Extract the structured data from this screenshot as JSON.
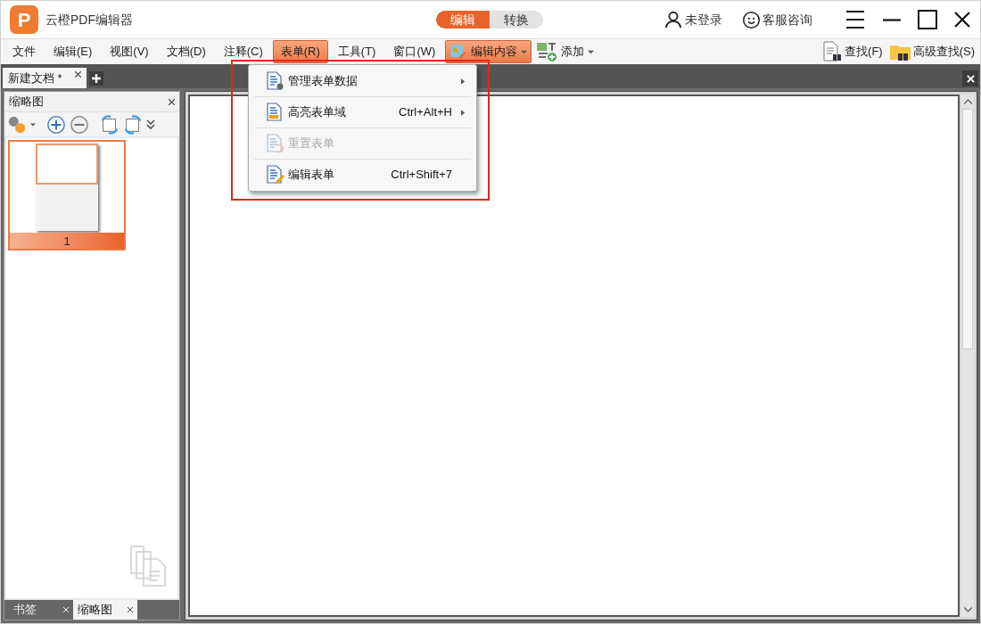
{
  "app": {
    "logo_letter": "P",
    "title": "云橙PDF编辑器"
  },
  "mode_switch": [
    {
      "label": "编辑",
      "selected": true
    },
    {
      "label": "转换",
      "selected": false
    }
  ],
  "title_actions": {
    "login": "未登录",
    "support": "客服咨询"
  },
  "menu_bar": [
    {
      "label": "文件",
      "selected": false
    },
    {
      "label": "编辑(E)",
      "selected": false
    },
    {
      "label": "视图(V)",
      "selected": false
    },
    {
      "label": "文档(D)",
      "selected": false
    },
    {
      "label": "注释(C)",
      "selected": false
    },
    {
      "label": "表单(R)",
      "selected": true
    },
    {
      "label": "工具(T)",
      "selected": false
    },
    {
      "label": "窗口(W)",
      "selected": false
    }
  ],
  "toolbar": [
    {
      "label": "编辑内容",
      "active": true
    },
    {
      "label": "添加",
      "active": false
    }
  ],
  "search_tools": [
    "查找(F)",
    "高级查找(S)"
  ],
  "doc_tabs": [
    {
      "label": "新建文档 *",
      "selected": true
    }
  ],
  "form_menu": [
    {
      "label": "管理表单数据",
      "submenu": true,
      "disabled": false
    },
    {
      "label": "高亮表单域",
      "shortcut": "Ctrl+Alt+H",
      "submenu": true,
      "disabled": false
    },
    {
      "label": "重置表单",
      "submenu": false,
      "disabled": true
    },
    {
      "label": "编辑表单",
      "shortcut": "Ctrl+Shift+7",
      "submenu": false,
      "disabled": false
    }
  ],
  "side_panel": {
    "title": "缩略图",
    "pages": [
      {
        "label": "1",
        "selected": true
      }
    ],
    "bottom_tabs": [
      {
        "label": "书签",
        "selected": false
      },
      {
        "label": "缩略图",
        "selected": true
      }
    ]
  }
}
